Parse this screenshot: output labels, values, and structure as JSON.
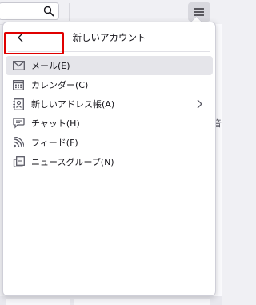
{
  "panel": {
    "title": "新しいアカウント",
    "back_icon": "chevron-left-icon"
  },
  "menu": {
    "items": [
      {
        "label": "メール(E)",
        "icon": "mail-icon",
        "hovered": true
      },
      {
        "label": "カレンダー(C)",
        "icon": "calendar-icon"
      },
      {
        "label": "新しいアドレス帳(A)",
        "icon": "address-book-icon",
        "has_submenu": true
      },
      {
        "label": "チャット(H)",
        "icon": "chat-icon"
      },
      {
        "label": "フィード(F)",
        "icon": "rss-feed-icon"
      },
      {
        "label": "ニュースグループ(N)",
        "icon": "newsgroup-icon"
      }
    ]
  },
  "background": {
    "partial_text": "音",
    "search_icon": "search-icon",
    "menu_icon": "hamburger-menu-icon"
  },
  "colors": {
    "highlight_border": "#e00000",
    "hover_bg": "#e5e5ea",
    "icon_color": "#5b5b66"
  }
}
